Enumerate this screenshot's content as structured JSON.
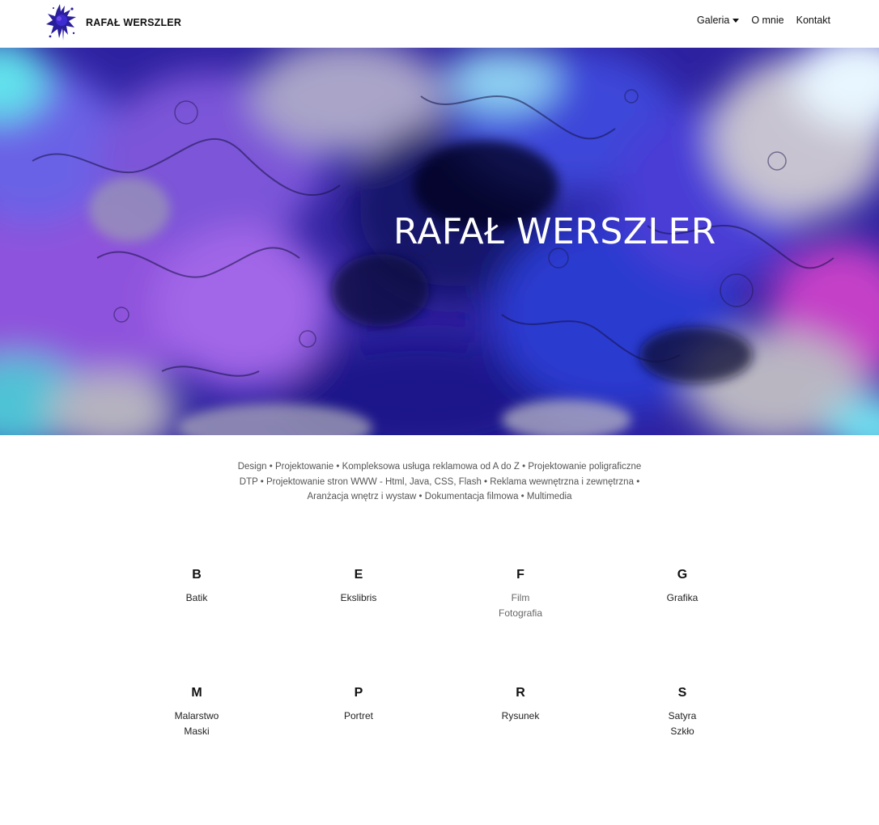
{
  "navbar": {
    "brand_name": "RAFAŁ WERSZLER",
    "items": [
      {
        "label": "Galeria",
        "has_dropdown": true
      },
      {
        "label": "O mnie"
      },
      {
        "label": "Kontakt"
      }
    ]
  },
  "hero": {
    "title": "RAFAŁ WERSZLER"
  },
  "services": {
    "lines": [
      [
        "Design",
        "Projektowanie",
        "Kompleksowa usługa reklamowa od A do Z",
        "Projektowanie poligraficzne"
      ],
      [
        "DTP",
        "Projektowanie stron WWW - Html, Java, CSS, Flash",
        "Reklama wewnętrzna i zewnętrzna"
      ],
      [
        "Aranżacja wnętrz i wystaw",
        "Dokumentacja filmowa",
        "Multimedia"
      ]
    ]
  },
  "index": [
    {
      "letter": "B",
      "items": [
        "Batik"
      ]
    },
    {
      "letter": "E",
      "items": [
        "Ekslibris"
      ]
    },
    {
      "letter": "F",
      "items": [
        "Film",
        "Fotografia"
      ]
    },
    {
      "letter": "G",
      "items": [
        "Grafika"
      ]
    },
    {
      "letter": "M",
      "items": [
        "Malarstwo",
        "Maski"
      ]
    },
    {
      "letter": "P",
      "items": [
        "Portret"
      ]
    },
    {
      "letter": "R",
      "items": [
        "Rysunek"
      ]
    },
    {
      "letter": "S",
      "items": [
        "Satyra",
        "Szkło"
      ]
    }
  ],
  "colors": {
    "accent": "#3b2fd4",
    "hero_dark": "#1a1463",
    "hero_violet": "#8a4fe0",
    "hero_cyan": "#5fd3e8",
    "hero_silver": "#b9b6c2",
    "hero_magenta": "#c43ac9"
  }
}
